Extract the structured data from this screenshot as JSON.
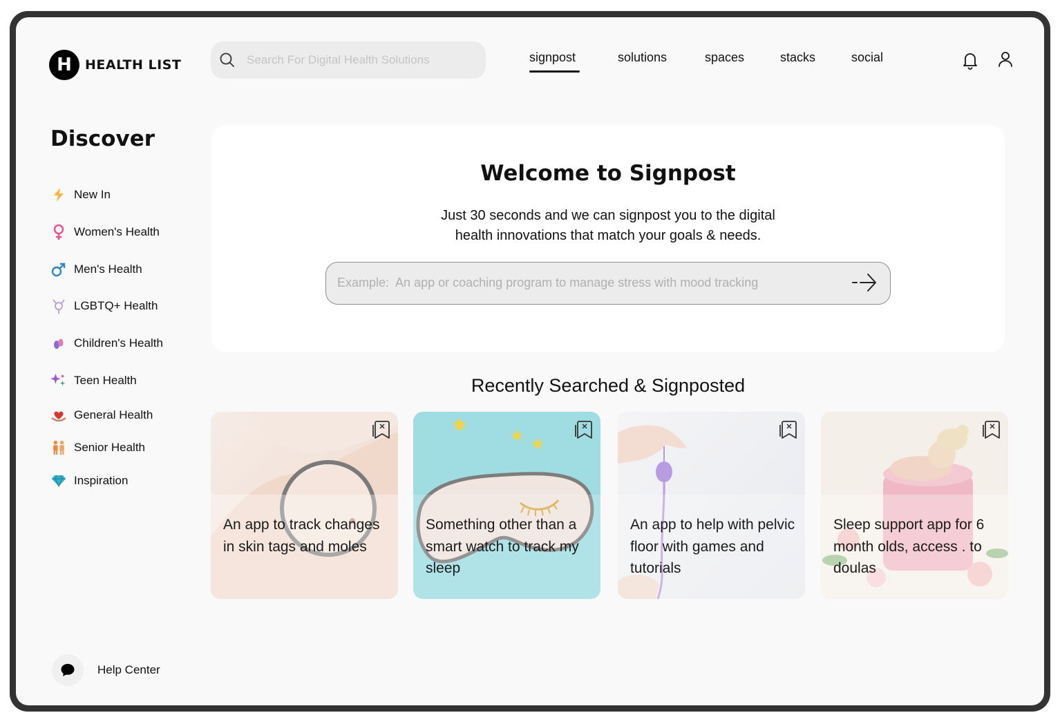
{
  "app": {
    "name": "HEALTH LIST",
    "logo_letter": "H"
  },
  "search": {
    "placeholder": "Search For Digital Health Solutions"
  },
  "nav": {
    "tabs": [
      {
        "label": "signpost",
        "active": true
      },
      {
        "label": "solutions",
        "active": false
      },
      {
        "label": "spaces",
        "active": false
      },
      {
        "label": "stacks",
        "active": false
      },
      {
        "label": "social",
        "active": false
      }
    ]
  },
  "header_icons": [
    "bell-icon",
    "user-icon"
  ],
  "sidebar": {
    "title": "Discover",
    "items": [
      {
        "label": "New In",
        "icon": "lightning-icon",
        "color": "#f6b73c"
      },
      {
        "label": "Women's Health",
        "icon": "female-symbol-icon",
        "color": "#e8558e"
      },
      {
        "label": "Men's Health",
        "icon": "male-symbol-icon",
        "color": "#2f86c9"
      },
      {
        "label": "LGBTQ+ Health",
        "icon": "transgender-symbol-icon",
        "color": "#b8a4d8"
      },
      {
        "label": "Children's Health",
        "icon": "baby-feet-icon",
        "color": "#8e6ad6"
      },
      {
        "label": "Teen Health",
        "icon": "sparkles-icon",
        "color": "#9b59d0"
      },
      {
        "label": "General Health",
        "icon": "heart-hands-icon",
        "color": "#d9382f"
      },
      {
        "label": "Senior Health",
        "icon": "people-icon",
        "color": "#f08a3a"
      },
      {
        "label": "Inspiration",
        "icon": "gem-icon",
        "color": "#2fb1c9"
      }
    ],
    "help": {
      "label": "Help Center",
      "icon": "chat-bubble-icon"
    }
  },
  "welcome": {
    "title": "Welcome to Signpost",
    "subtitle_line1": "Just 30 seconds and we can signpost you to  the digital",
    "subtitle_line2": "health innovations that match your goals & needs.",
    "prompt_placeholder": "Example:  An app or coaching program to manage stress with mood tracking"
  },
  "recent": {
    "title": "Recently Searched & Signposted",
    "cards": [
      {
        "text": "An app to track changes in skin tags and moles",
        "image": "magnifying-glass-on-shoulder"
      },
      {
        "text": "Something other than a smart watch to track my sleep",
        "image": "sleep-mask-on-blue"
      },
      {
        "text": "An app to help with pelvic floor with games and tutorials",
        "image": "hand-holding-pelvic-device"
      },
      {
        "text": "Sleep support app for 6 month olds, access . to doulas",
        "image": "newborn-in-pink-box"
      }
    ]
  },
  "colors": {
    "frame": "#333333",
    "screen_bg": "#f9f9f9",
    "card_bg": "#ffffff",
    "input_bg": "#ececec"
  }
}
